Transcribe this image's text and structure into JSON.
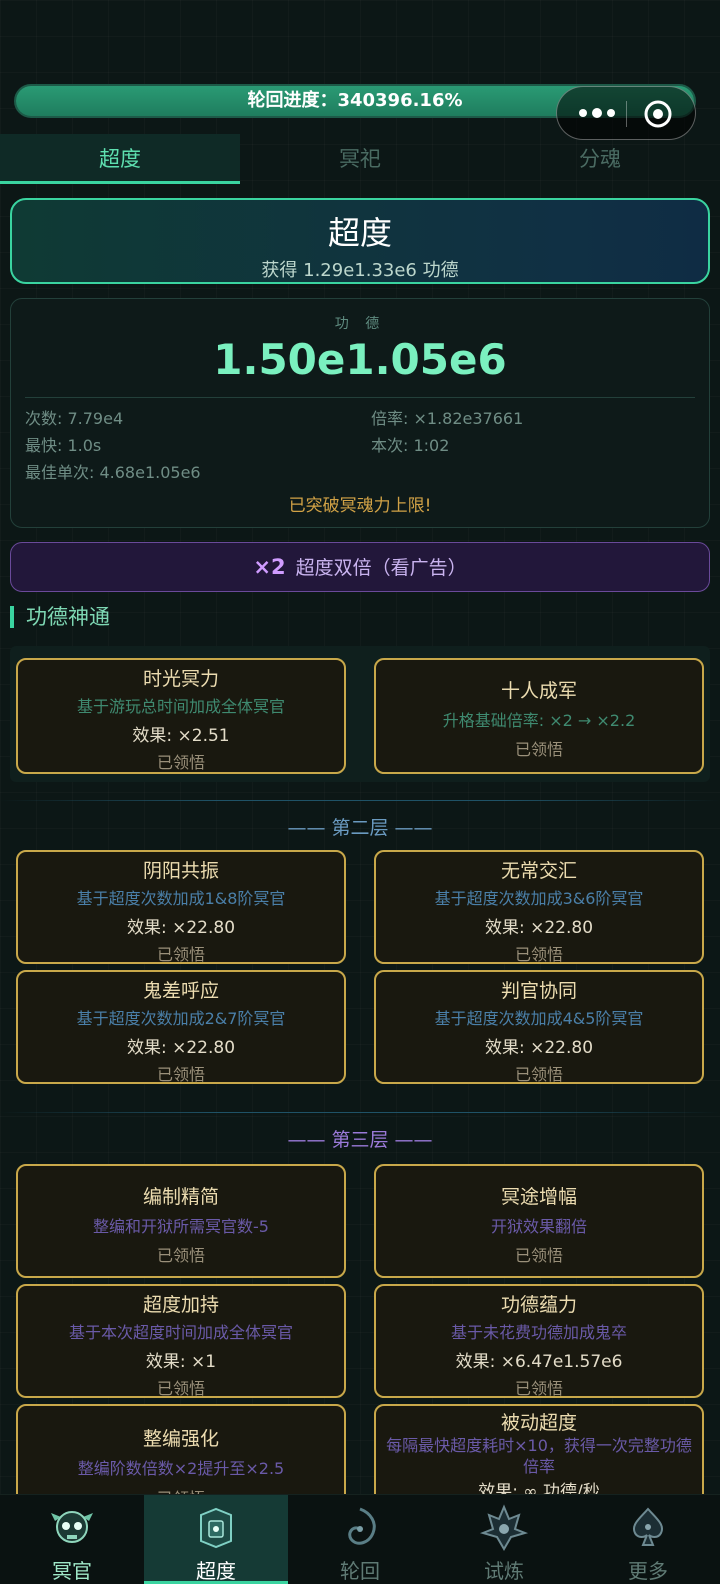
{
  "header": {
    "progress_text": "轮回进度：340396.16%",
    "progress_fraction": 1.0
  },
  "tabs": [
    {
      "label": "超度"
    },
    {
      "label": "冥祀"
    },
    {
      "label": "分魂"
    }
  ],
  "rebirth": {
    "title": "超度",
    "subtitle": "获得 1.29e1.33e6 功德"
  },
  "stats": {
    "label": "功 德",
    "value": "1.50e1.05e6",
    "count": "次数: 7.79e4",
    "multiplier": "倍率: ×1.82e37661",
    "fastest": "最快: 1.0s",
    "current": "本次: 1:02",
    "best_single": "最佳单次: 4.68e1.05e6",
    "notice": "已突破冥魂力上限!"
  },
  "double": {
    "badge": "×2",
    "label": "超度双倍（看广告）"
  },
  "section_title": "功德神通",
  "layer1": {
    "cards": [
      {
        "name": "时光冥力",
        "desc": "基于游玩总时间加成全体冥官",
        "effect": "效果: ×2.51",
        "status": "已领悟"
      },
      {
        "name": "十人成军",
        "desc": "升格基础倍率: ×2 → ×2.2",
        "status": "已领悟"
      }
    ]
  },
  "layer2": {
    "title": "—— 第二层 ——",
    "cards": [
      {
        "name": "阴阳共振",
        "desc": "基于超度次数加成1&8阶冥官",
        "effect": "效果: ×22.80",
        "status": "已领悟"
      },
      {
        "name": "无常交汇",
        "desc": "基于超度次数加成3&6阶冥官",
        "effect": "效果: ×22.80",
        "status": "已领悟"
      },
      {
        "name": "鬼差呼应",
        "desc": "基于超度次数加成2&7阶冥官",
        "effect": "效果: ×22.80",
        "status": "已领悟"
      },
      {
        "name": "判官协同",
        "desc": "基于超度次数加成4&5阶冥官",
        "effect": "效果: ×22.80",
        "status": "已领悟"
      }
    ]
  },
  "layer3": {
    "title": "—— 第三层 ——",
    "cards": [
      {
        "name": "编制精简",
        "desc": "整编和开狱所需冥官数-5",
        "status": "已领悟"
      },
      {
        "name": "冥途增幅",
        "desc": "开狱效果翻倍",
        "status": "已领悟"
      },
      {
        "name": "超度加持",
        "desc": "基于本次超度时间加成全体冥官",
        "effect": "效果: ×1",
        "status": "已领悟"
      },
      {
        "name": "功德蕴力",
        "desc": "基于未花费功德加成鬼卒",
        "effect": "效果: ×6.47e1.57e6",
        "status": "已领悟"
      },
      {
        "name": "整编强化",
        "desc": "整编阶数倍数×2提升至×2.5",
        "status": "已领悟"
      },
      {
        "name": "被动超度",
        "desc": "每隔最快超度耗时×10，获得一次完整功德倍率",
        "effect": "效果: ∞ 功德/秒"
      }
    ]
  },
  "bottom_nav": [
    {
      "label": "冥官",
      "icon": "skull-emblem-icon"
    },
    {
      "label": "超度",
      "icon": "lotus-altar-icon"
    },
    {
      "label": "轮回",
      "icon": "swirl-emblem-icon"
    },
    {
      "label": "试炼",
      "icon": "flame-emblem-icon"
    },
    {
      "label": "更多",
      "icon": "spade-emblem-icon"
    }
  ],
  "colors": {
    "accent": "#3ad4a0",
    "gold_border": "#c8a84a",
    "purple": "#c9b3ef"
  }
}
